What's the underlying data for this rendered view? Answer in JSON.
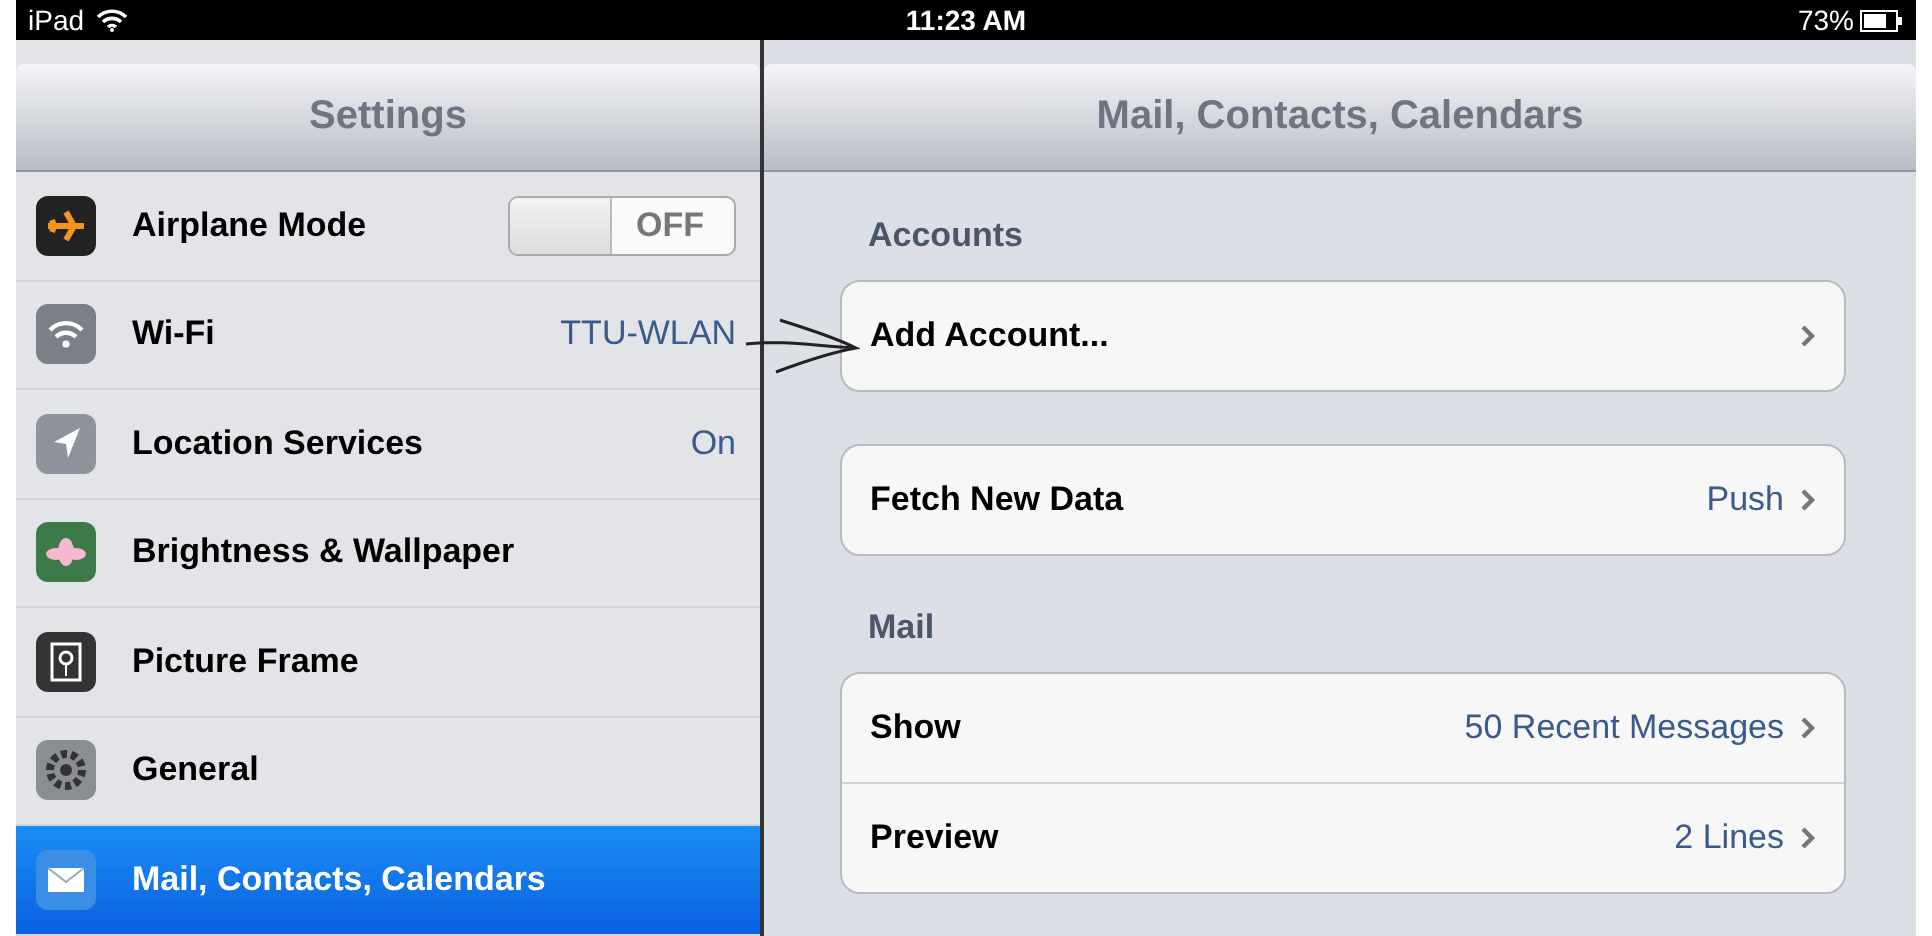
{
  "status_bar": {
    "device": "iPad",
    "time": "11:23 AM",
    "battery": "73%"
  },
  "sidebar": {
    "title": "Settings",
    "items": [
      {
        "label": "Airplane Mode",
        "kind": "toggle",
        "on": false,
        "value": "OFF",
        "selected": false
      },
      {
        "label": "Wi-Fi",
        "kind": "value",
        "value": "TTU-WLAN",
        "selected": false
      },
      {
        "label": "Location Services",
        "kind": "value",
        "value": "On",
        "selected": false
      },
      {
        "label": "Brightness & Wallpaper",
        "kind": "plain",
        "selected": false
      },
      {
        "label": "Picture Frame",
        "kind": "plain",
        "selected": false
      },
      {
        "label": "General",
        "kind": "plain",
        "selected": false
      },
      {
        "label": "Mail, Contacts, Calendars",
        "kind": "plain",
        "selected": true
      }
    ]
  },
  "detail": {
    "title": "Mail, Contacts, Calendars",
    "sections": [
      {
        "header": "Accounts",
        "rows": [
          {
            "label": "Add Account..."
          }
        ]
      },
      {
        "rows": [
          {
            "label": "Fetch New Data",
            "value": "Push"
          }
        ]
      },
      {
        "header": "Mail",
        "rows": [
          {
            "label": "Show",
            "value": "50 Recent Messages"
          },
          {
            "label": "Preview",
            "value": "2 Lines"
          }
        ]
      }
    ]
  }
}
